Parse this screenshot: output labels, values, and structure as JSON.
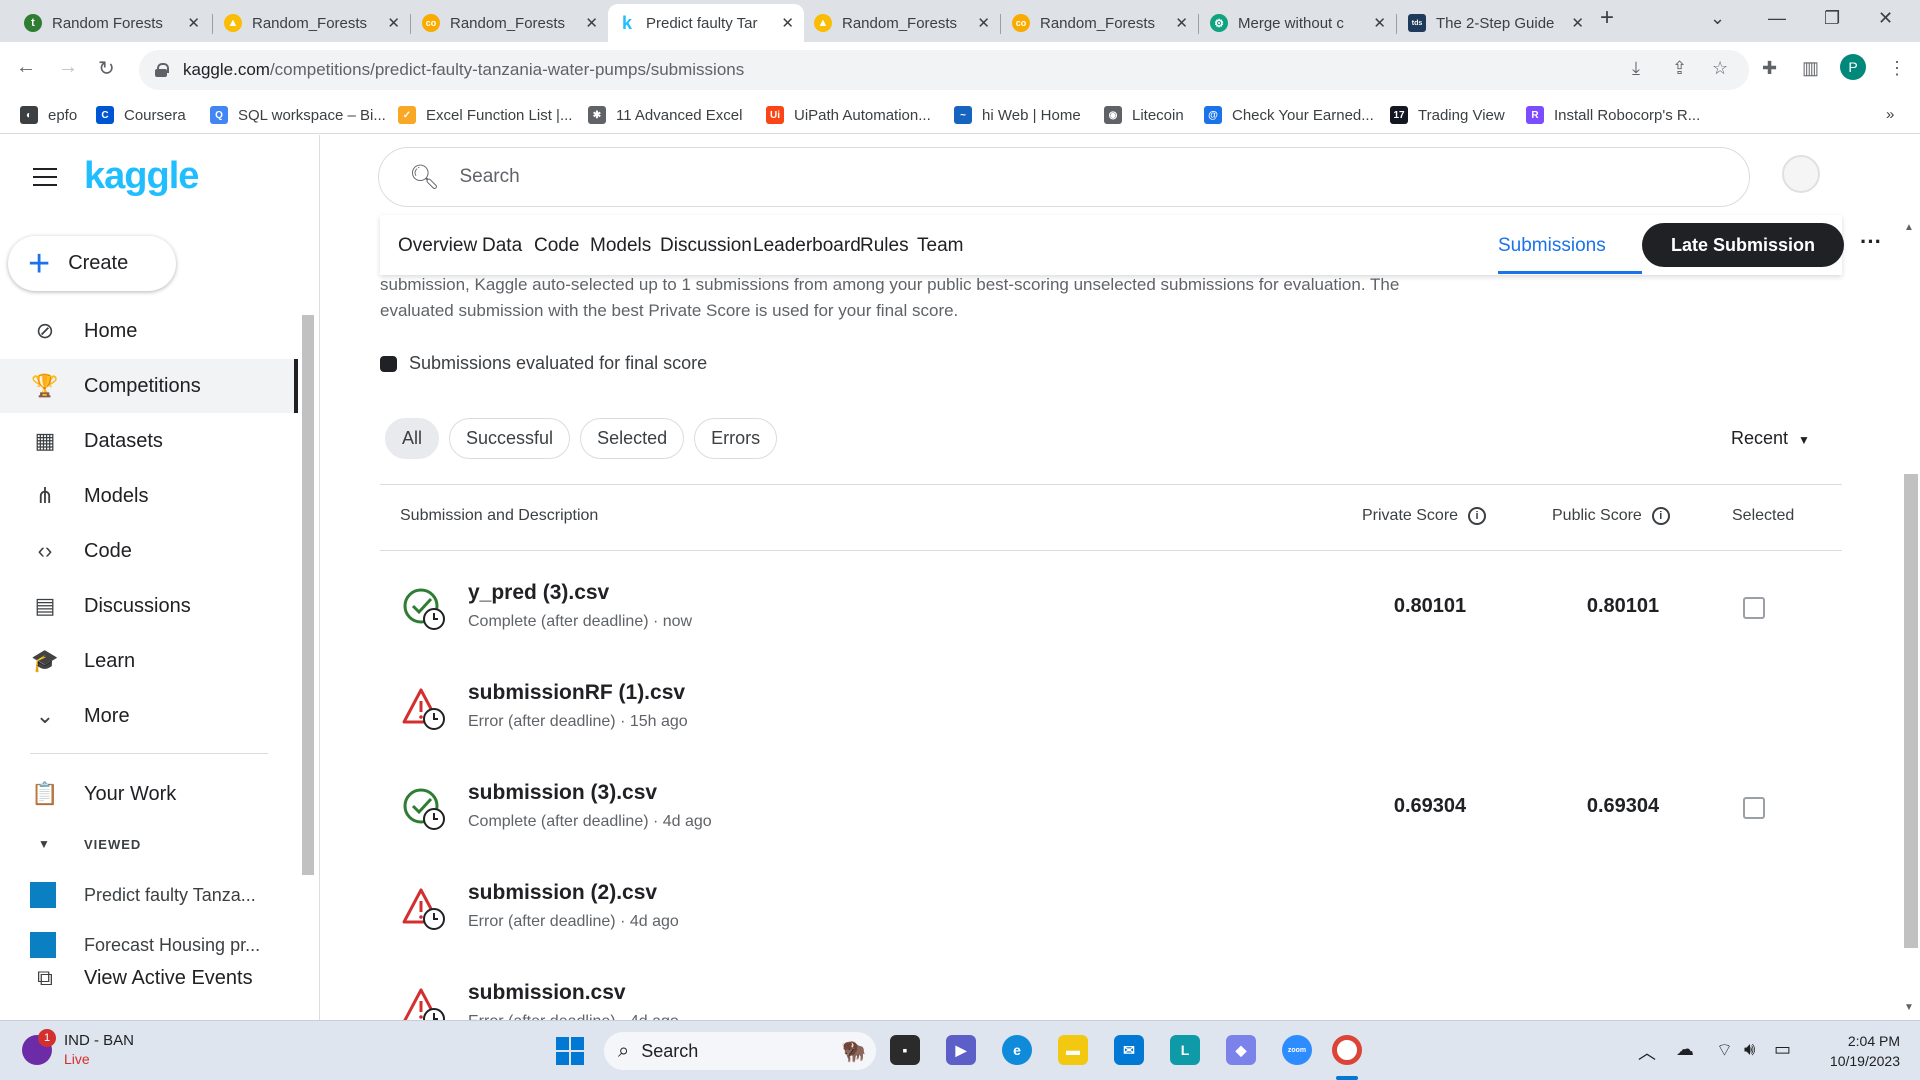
{
  "browser": {
    "tabs": [
      {
        "title": "Random Forests",
        "favicon_color": "#2e7d32",
        "favicon_letter": "t"
      },
      {
        "title": "Random_Forests",
        "favicon_color": "#fbbc04",
        "favicon_letter": "▲"
      },
      {
        "title": "Random_Forests",
        "favicon_color": "#f9ab00",
        "favicon_letter": "co"
      },
      {
        "title": "Predict faulty Tar",
        "favicon_color": "#20beff",
        "favicon_letter": "k"
      },
      {
        "title": "Random_Forests",
        "favicon_color": "#fbbc04",
        "favicon_letter": "▲"
      },
      {
        "title": "Random_Forests",
        "favicon_color": "#f9ab00",
        "favicon_letter": "co"
      },
      {
        "title": "Merge without c",
        "favicon_color": "#10a37f",
        "favicon_letter": "⚙"
      },
      {
        "title": "The 2-Step Guide",
        "favicon_color": "#1f3b5c",
        "favicon_letter": "tds"
      }
    ],
    "url_host": "kaggle.com",
    "url_path": "/competitions/predict-faulty-tanzania-water-pumps/submissions",
    "profile_initial": "P",
    "bookmarks": [
      {
        "label": "epfo",
        "color": "#3c4043",
        "glyph": "◐"
      },
      {
        "label": "Coursera",
        "color": "#0056d2",
        "glyph": "C"
      },
      {
        "label": "SQL workspace – Bi...",
        "color": "#4285f4",
        "glyph": "Q"
      },
      {
        "label": "Excel Function List |...",
        "color": "#f9a825",
        "glyph": "✓"
      },
      {
        "label": "11 Advanced Excel",
        "color": "#5f6368",
        "glyph": "✱"
      },
      {
        "label": "UiPath Automation...",
        "color": "#fa4616",
        "glyph": "Ui"
      },
      {
        "label": "hi Web | Home",
        "color": "#1565c0",
        "glyph": "~"
      },
      {
        "label": "Litecoin",
        "color": "#5f6368",
        "glyph": "◉"
      },
      {
        "label": "Check Your Earned...",
        "color": "#1a73e8",
        "glyph": "@"
      },
      {
        "label": "Trading View",
        "color": "#131722",
        "glyph": "17"
      },
      {
        "label": "Install Robocorp's R...",
        "color": "#7c4dff",
        "glyph": "R"
      }
    ]
  },
  "sidebar": {
    "logo": "kaggle",
    "create_label": "Create",
    "items": [
      {
        "label": "Home",
        "icon": "compass-icon",
        "glyph": "⊘"
      },
      {
        "label": "Competitions",
        "icon": "trophy-icon",
        "glyph": "🏆"
      },
      {
        "label": "Datasets",
        "icon": "table-icon",
        "glyph": "▦"
      },
      {
        "label": "Models",
        "icon": "models-icon",
        "glyph": "⋔"
      },
      {
        "label": "Code",
        "icon": "code-icon",
        "glyph": "‹›"
      },
      {
        "label": "Discussions",
        "icon": "discussions-icon",
        "glyph": "▤"
      },
      {
        "label": "Learn",
        "icon": "learn-icon",
        "glyph": "🎓"
      },
      {
        "label": "More",
        "icon": "chevron-down-icon",
        "glyph": "⌄"
      }
    ],
    "your_work": "Your Work",
    "viewed_label": "VIEWED",
    "viewed": [
      "Predict faulty Tanza...",
      "Forecast Housing pr..."
    ],
    "view_events": "View Active Events"
  },
  "search": {
    "placeholder": "Search"
  },
  "competition_tabs": [
    "Overview",
    "Data",
    "Code",
    "Models",
    "Discussion",
    "Leaderboard",
    "Rules",
    "Team"
  ],
  "active_tab": "Submissions",
  "late_submission": "Late Submission",
  "info_text": "submission, Kaggle auto-selected up to 1 submissions from among your public best-scoring unselected submissions for evaluation. The evaluated submission with the best Private Score is used for your final score.",
  "legend_label": "Submissions evaluated for final score",
  "filters": [
    "All",
    "Successful",
    "Selected",
    "Errors"
  ],
  "sort_label": "Recent",
  "table": {
    "headers": {
      "description": "Submission and Description",
      "private": "Private Score",
      "public": "Public Score",
      "selected": "Selected"
    },
    "rows": [
      {
        "name": "y_pred (3).csv",
        "status": "Complete (after deadline) · now",
        "ok": true,
        "private": "0.80101",
        "public": "0.80101"
      },
      {
        "name": "submissionRF (1).csv",
        "status": "Error (after deadline) · 15h ago",
        "ok": false,
        "private": "",
        "public": ""
      },
      {
        "name": "submission (3).csv",
        "status": "Complete (after deadline) · 4d ago",
        "ok": true,
        "private": "0.69304",
        "public": "0.69304"
      },
      {
        "name": "submission (2).csv",
        "status": "Error (after deadline) · 4d ago",
        "ok": false,
        "private": "",
        "public": ""
      },
      {
        "name": "submission.csv",
        "status": "Error (after deadline) · 4d ago",
        "ok": false,
        "private": "",
        "public": ""
      }
    ]
  },
  "taskbar": {
    "weather_title": "IND - BAN",
    "weather_sub": "Live",
    "badge": "1",
    "search_label": "Search",
    "time": "2:04 PM",
    "date": "10/19/2023"
  },
  "colors": {
    "accent": "#1a73e8",
    "kaggle": "#20beff",
    "success": "#2e7d32",
    "error": "#d32f2f"
  }
}
